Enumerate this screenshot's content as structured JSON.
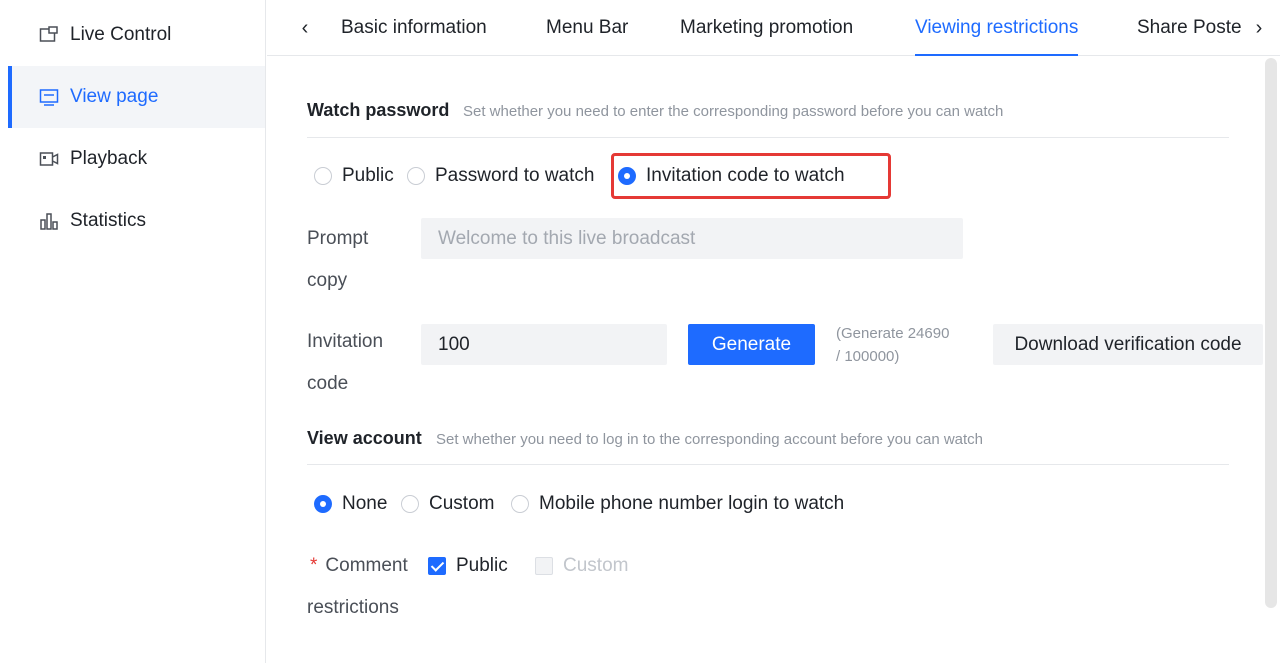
{
  "sidebar": {
    "items": [
      {
        "label": "Live Control",
        "icon": "monitor-window-icon"
      },
      {
        "label": "View page",
        "icon": "screen-icon"
      },
      {
        "label": "Playback",
        "icon": "video-camera-icon"
      },
      {
        "label": "Statistics",
        "icon": "bar-chart-icon"
      }
    ],
    "active_index": 1
  },
  "tabs": {
    "items": [
      "Basic information",
      "Menu Bar",
      "Marketing promotion",
      "Viewing restrictions",
      "Share Poste"
    ],
    "active": "Viewing restrictions",
    "prev_icon": "chevron-left-icon",
    "next_icon": "chevron-right-icon"
  },
  "watch_password": {
    "title": "Watch password",
    "description": "Set whether you need to enter the corresponding password before you can watch",
    "options": [
      "Public",
      "Password to watch",
      "Invitation code to watch"
    ],
    "selected": "Invitation code to watch",
    "prompt_label_line1": "Prompt",
    "prompt_label_line2": "copy",
    "prompt_placeholder": "Welcome to this live broadcast",
    "invitation_label_line1": "Invitation",
    "invitation_label_line2": "code",
    "invitation_value": "100",
    "generate_label": "Generate",
    "hint_line1": "(Generate 24690",
    "hint_line2": "/ 100000)",
    "download_label": "Download verification code"
  },
  "view_account": {
    "title": "View account",
    "description": "Set whether you need to log in to the corresponding account before you can watch",
    "options": [
      "None",
      "Custom",
      "Mobile phone number login to watch"
    ],
    "selected": "None"
  },
  "comment_restrictions": {
    "required_mark": "*",
    "label_line1": "Comment",
    "label_line2": "restrictions",
    "options": [
      {
        "label": "Public",
        "checked": true,
        "disabled": false
      },
      {
        "label": "Custom",
        "checked": false,
        "disabled": true
      }
    ]
  },
  "colors": {
    "accent": "#1e6bff",
    "highlight_border": "#e53935"
  }
}
